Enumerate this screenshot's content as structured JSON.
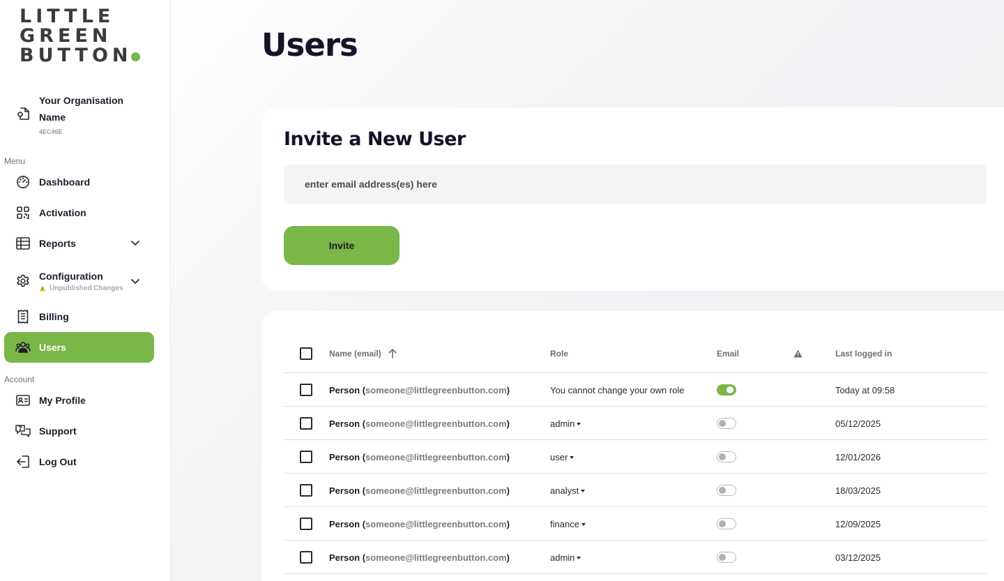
{
  "logo": {
    "line1": "LITTLE",
    "line2": "GREEN",
    "line3": "BUTTON"
  },
  "colors": {
    "accent": "#7ab648",
    "title": "#13132a",
    "warning": "#e8c440"
  },
  "org": {
    "name": "Your Organisation Name",
    "code": "4EC46E",
    "icon": "org-pin-icon"
  },
  "sidebar": {
    "menu_label": "Menu",
    "account_label": "Account",
    "items": [
      {
        "label": "Dashboard",
        "icon": "dashboard-gauge-icon"
      },
      {
        "label": "Activation",
        "icon": "qr-code-icon"
      },
      {
        "label": "Reports",
        "icon": "table-icon",
        "expandable": true
      },
      {
        "label": "Configuration",
        "icon": "gear-icon",
        "expandable": true,
        "warning": "Unpublished Changes"
      },
      {
        "label": "Billing",
        "icon": "receipt-icon"
      },
      {
        "label": "Users",
        "icon": "users-icon",
        "active": true
      }
    ],
    "account_items": [
      {
        "label": "My Profile",
        "icon": "id-card-icon"
      },
      {
        "label": "Support",
        "icon": "chat-question-icon"
      },
      {
        "label": "Log Out",
        "icon": "logout-icon"
      }
    ]
  },
  "page": {
    "title": "Users"
  },
  "invite": {
    "title": "Invite a New User",
    "placeholder": "enter email address(es) here",
    "button": "Invite"
  },
  "table": {
    "headers": {
      "name": "Name (email)",
      "role": "Role",
      "email": "Email",
      "last_logged_in": "Last logged in"
    },
    "sort_icon": "arrow-up-icon",
    "warning_icon": "warning-triangle-icon",
    "rows": [
      {
        "name": "Person",
        "email": "someone@littlegreenbutton.com",
        "role": "You cannot change your own role",
        "role_editable": false,
        "email_on": true,
        "last": "Today at 09:58"
      },
      {
        "name": "Person",
        "email": "someone@littlegreenbutton.com",
        "role": "admin",
        "role_editable": true,
        "email_on": false,
        "last": "05/12/2025"
      },
      {
        "name": "Person",
        "email": "someone@littlegreenbutton.com",
        "role": "user",
        "role_editable": true,
        "email_on": false,
        "last": "12/01/2026"
      },
      {
        "name": "Person",
        "email": "someone@littlegreenbutton.com",
        "role": "analyst",
        "role_editable": true,
        "email_on": false,
        "last": "18/03/2025"
      },
      {
        "name": "Person",
        "email": "someone@littlegreenbutton.com",
        "role": "finance",
        "role_editable": true,
        "email_on": false,
        "last": "12/09/2025"
      },
      {
        "name": "Person",
        "email": "someone@littlegreenbutton.com",
        "role": "admin",
        "role_editable": true,
        "email_on": false,
        "last": "03/12/2025"
      }
    ]
  }
}
